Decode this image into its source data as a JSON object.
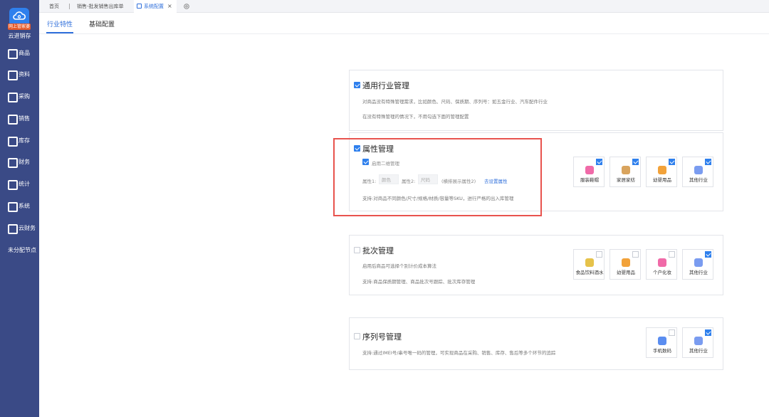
{
  "sidebar": {
    "logo_tag": "网上管家婆",
    "logo_name": "云进销存",
    "items": [
      {
        "label": "商品",
        "icon": "box-icon"
      },
      {
        "label": "资料",
        "icon": "document-icon"
      },
      {
        "label": "采购",
        "icon": "cart-icon"
      },
      {
        "label": "销售",
        "icon": "chart-icon"
      },
      {
        "label": "库存",
        "icon": "warehouse-icon"
      },
      {
        "label": "财务",
        "icon": "wallet-icon"
      },
      {
        "label": "统计",
        "icon": "stats-icon"
      },
      {
        "label": "系统",
        "icon": "gear-icon"
      },
      {
        "label": "云财务",
        "icon": "cloud-finance-icon"
      },
      {
        "label": "未分配节点",
        "icon": ""
      }
    ]
  },
  "tabbar": {
    "tabs": [
      {
        "label": "首页"
      },
      {
        "label": "销售-批发销售出库单"
      },
      {
        "label": "系统配置",
        "close": "×"
      }
    ]
  },
  "subtabs": [
    {
      "label": "行业特性"
    },
    {
      "label": "基础配置"
    }
  ],
  "cards": {
    "general": {
      "title": "通用行业管理",
      "desc1": "对商品没有特殊管理需求，比如颜色、尺码、保质期、序列号：如五金行业、汽车配件行业",
      "desc2": "在没有特殊管理的情况下，不用勾选下面的管理配置"
    },
    "attribute": {
      "title": "属性管理",
      "sub_option": "启用二维管理",
      "attr1_label": "属性1:",
      "attr1_value": "颜色",
      "attr2_label": "属性2:",
      "attr2_value": "尺码",
      "hint": "(横排展示属性2)",
      "link": "去设置属性",
      "desc": "支持:对商品不同颜色/尺寸/规格/材质/容量等SKU，进行严格的出入库管理",
      "tiles": [
        {
          "label": "服装鞋帽",
          "checked": true,
          "color": "#f06aa8"
        },
        {
          "label": "家居家纺",
          "checked": true,
          "color": "#d9a45e"
        },
        {
          "label": "幼婴用品",
          "checked": true,
          "color": "#f2a23a"
        },
        {
          "label": "其他行业",
          "checked": true,
          "color": "#7a9cf0"
        }
      ]
    },
    "batch": {
      "title": "批次管理",
      "desc1": "启用后商品可选择个别计价成本算法",
      "desc2": "支持:商品保质期管理、商品批次号跟踪、批次库存管理",
      "tiles": [
        {
          "label": "食品饮料酒水",
          "checked": false,
          "color": "#e6c24a"
        },
        {
          "label": "幼婴用品",
          "checked": false,
          "color": "#f2a23a"
        },
        {
          "label": "个户化妆",
          "checked": false,
          "color": "#f06aa8"
        },
        {
          "label": "其他行业",
          "checked": true,
          "color": "#7a9cf0"
        }
      ]
    },
    "serial": {
      "title": "序列号管理",
      "desc": "支持:通过IMEI号/串号唯一码的管理，可实现商品在采购、销售、库存、售后等多个环节的追踪",
      "tiles": [
        {
          "label": "手机数码",
          "checked": false,
          "color": "#5a8df0"
        },
        {
          "label": "其他行业",
          "checked": true,
          "color": "#7a9cf0"
        }
      ]
    }
  }
}
